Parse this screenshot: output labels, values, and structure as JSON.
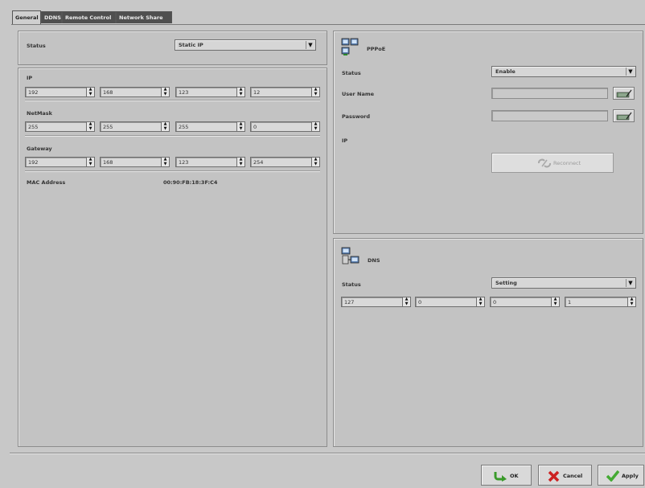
{
  "tabs": [
    "General",
    "DDNS",
    "Remote Control",
    "Network Share"
  ],
  "general": {
    "status_label": "Status",
    "status_value": "Static IP",
    "ip_label": "IP",
    "ip": [
      "192",
      "168",
      "123",
      "12"
    ],
    "netmask_label": "NetMask",
    "netmask": [
      "255",
      "255",
      "255",
      "0"
    ],
    "gateway_label": "Gateway",
    "gateway": [
      "192",
      "168",
      "123",
      "254"
    ],
    "mac_label": "MAC Address",
    "mac_value": "00:90:FB:18:3F:C4"
  },
  "pppoe": {
    "title": "PPPoE",
    "status_label": "Status",
    "status_value": "Enable",
    "username_label": "User Name",
    "username_value": "",
    "password_label": "Password",
    "password_value": "",
    "ip_label": "IP",
    "reconnect_label": "Reconnect"
  },
  "dns": {
    "title": "DNS",
    "status_label": "Status",
    "status_value": "Setting",
    "values": [
      "127",
      "0",
      "0",
      "1"
    ]
  },
  "buttons": {
    "ok": "OK",
    "cancel": "Cancel",
    "apply": "Apply"
  },
  "icons": {
    "pppoe": "network-computers-icon",
    "dns": "dns-computers-icon",
    "keyboard": "keyboard-icon",
    "reconnect": "reconnect-icon",
    "ok": "ok-arrow-icon",
    "cancel": "cancel-x-icon",
    "apply": "apply-check-icon"
  },
  "colors": {
    "ok_green": "#3a9a2a",
    "cancel_red": "#cc2222",
    "apply_green": "#44aa33"
  }
}
